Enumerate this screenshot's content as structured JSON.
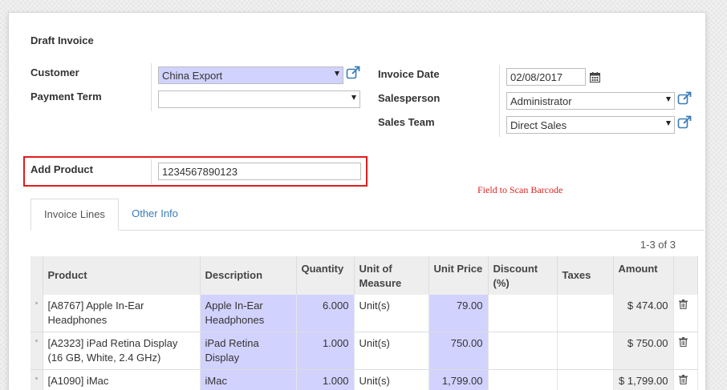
{
  "doc": {
    "title": "Draft Invoice"
  },
  "form": {
    "customer_label": "Customer",
    "customer_value": "China Export",
    "payment_term_label": "Payment Term",
    "payment_term_value": "",
    "invoice_date_label": "Invoice Date",
    "invoice_date_value": "02/08/2017",
    "salesperson_label": "Salesperson",
    "salesperson_value": "Administrator",
    "sales_team_label": "Sales Team",
    "sales_team_value": "Direct Sales",
    "add_product_label": "Add Product",
    "add_product_value": "1234567890123"
  },
  "annotation": {
    "text": "Field to Scan Barcode",
    "color": "#e02020"
  },
  "tabs": [
    {
      "label": "Invoice Lines"
    },
    {
      "label": "Other Info"
    }
  ],
  "pager": "1-3 of 3",
  "table": {
    "headers": [
      "Product",
      "Description",
      "Quantity",
      "Unit of Measure",
      "Unit Price",
      "Discount (%)",
      "Taxes",
      "Amount"
    ],
    "rows": [
      {
        "product": "[A8767] Apple In-Ear Headphones",
        "description": "Apple In-Ear Headphones",
        "quantity": "6.000",
        "uom": "Unit(s)",
        "unit_price": "79.00",
        "discount": "",
        "taxes": "",
        "amount": "$ 474.00"
      },
      {
        "product": "[A2323] iPad Retina Display (16 GB, White, 2.4 GHz)",
        "description": "iPad Retina Display",
        "quantity": "1.000",
        "uom": "Unit(s)",
        "unit_price": "750.00",
        "discount": "",
        "taxes": "",
        "amount": "$ 750.00"
      },
      {
        "product": "[A1090] iMac",
        "description": "iMac",
        "quantity": "1.000",
        "uom": "Unit(s)",
        "unit_price": "1,799.00",
        "discount": "",
        "taxes": "",
        "amount": "$ 1,799.00"
      }
    ]
  },
  "icons": {
    "external_link": "external-link-icon",
    "calendar": "calendar-icon",
    "trash": "trash-icon"
  },
  "colors": {
    "required_field": "#d2d2ff",
    "link": "#3a7bb8",
    "highlight": "#e21d1d"
  }
}
